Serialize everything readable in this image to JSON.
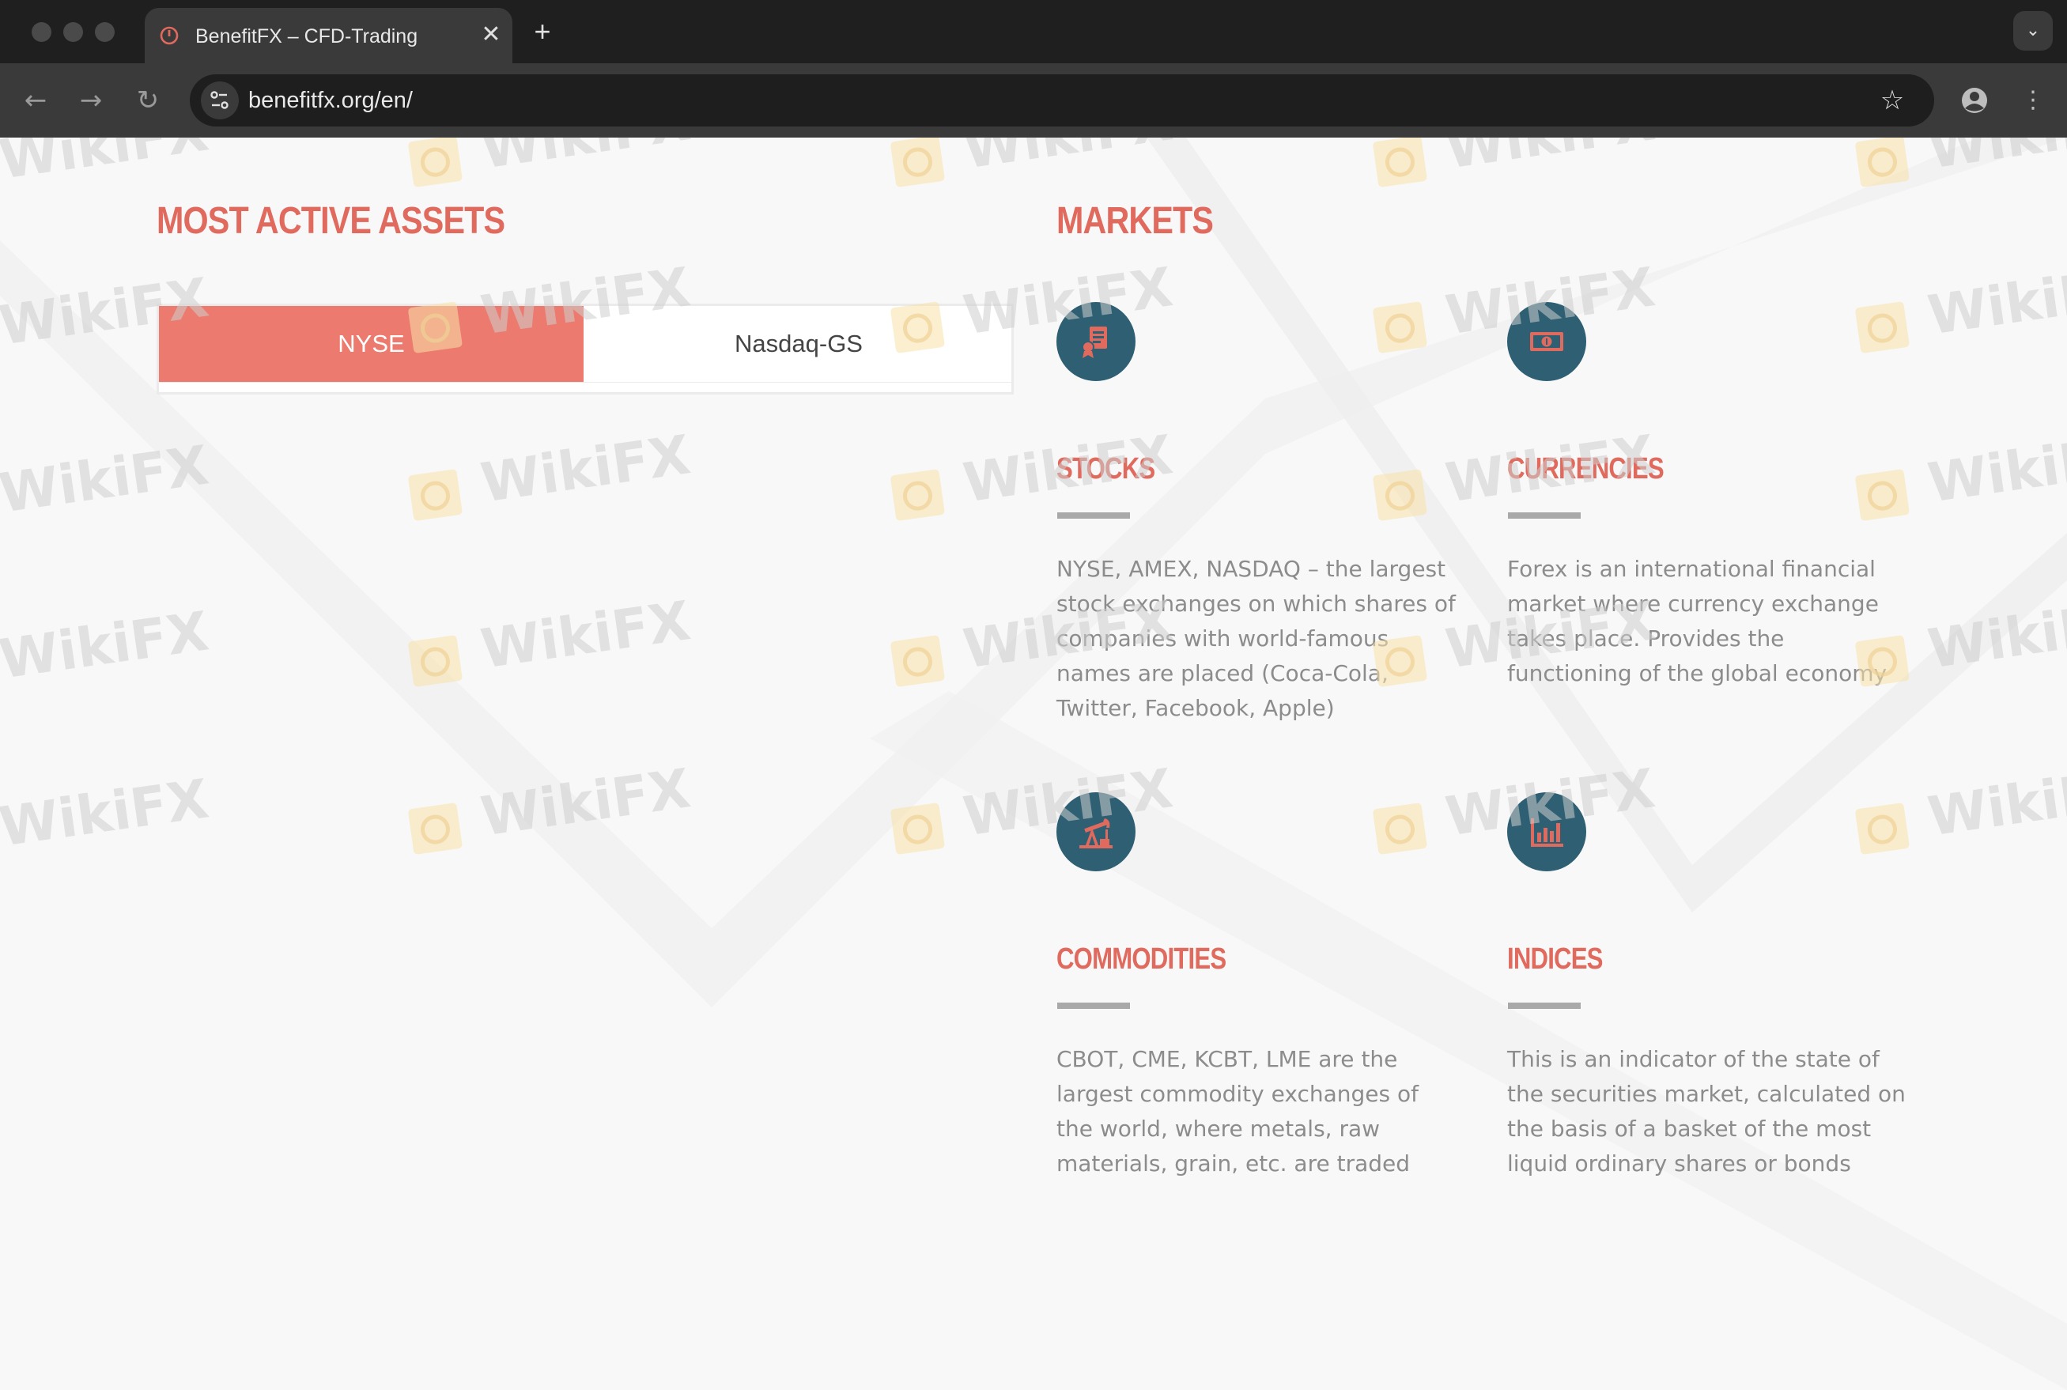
{
  "browser": {
    "tab_title": "BenefitFX – CFD-Trading",
    "tab_close": "✕",
    "new_tab": "+",
    "url": "benefitfx.org/en/",
    "icons": [
      "back-arrow-icon",
      "forward-arrow-icon",
      "reload-icon",
      "site-info-icon",
      "bookmark-star-icon",
      "profile-icon",
      "more-menu-icon",
      "tab-list-chevron-icon"
    ]
  },
  "colors": {
    "accent": "#e06a5e",
    "tab_active": "#ec7a6e",
    "icon_circle": "#2f5f72",
    "body_text": "#8c8c8c"
  },
  "assets": {
    "heading": "MOST ACTIVE ASSETS",
    "tabs": [
      {
        "label": "NYSE",
        "active": true
      },
      {
        "label": "Nasdaq-GS",
        "active": false
      }
    ]
  },
  "markets": {
    "heading": "MARKETS",
    "items": [
      {
        "title": "STOCKS",
        "icon": "stock-certificate-icon",
        "description": "NYSE, AMEX, NASDAQ – the largest stock exchanges on which shares of companies with world-famous names are placed (Coca-Cola, Twitter, Facebook, Apple)"
      },
      {
        "title": "CURRENCIES",
        "icon": "banknote-icon",
        "description": "Forex is an international financial market where currency exchange takes place. Provides the functioning of the global economy"
      },
      {
        "title": "COMMODITIES",
        "icon": "oil-pump-icon",
        "description": "CBOT, CME, KCBT, LME are the largest commodity exchanges of the world, where metals, raw materials, grain, etc. are traded"
      },
      {
        "title": "INDICES",
        "icon": "bar-chart-icon",
        "description": "This is an indicator of the state of the securities market, calculated on the basis of a basket of the most liquid ordinary shares or bonds"
      }
    ]
  },
  "watermark": {
    "text": "WikiFX"
  }
}
